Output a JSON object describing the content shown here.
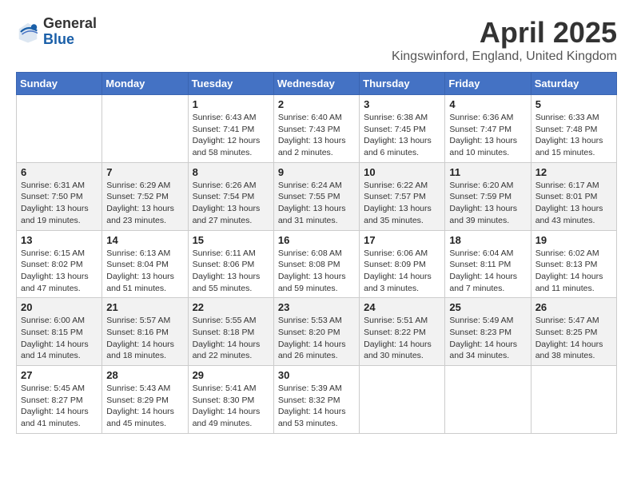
{
  "logo": {
    "general": "General",
    "blue": "Blue"
  },
  "title": "April 2025",
  "subtitle": "Kingswinford, England, United Kingdom",
  "days_of_week": [
    "Sunday",
    "Monday",
    "Tuesday",
    "Wednesday",
    "Thursday",
    "Friday",
    "Saturday"
  ],
  "weeks": [
    [
      {
        "day": "",
        "info": ""
      },
      {
        "day": "",
        "info": ""
      },
      {
        "day": "1",
        "info": "Sunrise: 6:43 AM\nSunset: 7:41 PM\nDaylight: 12 hours and 58 minutes."
      },
      {
        "day": "2",
        "info": "Sunrise: 6:40 AM\nSunset: 7:43 PM\nDaylight: 13 hours and 2 minutes."
      },
      {
        "day": "3",
        "info": "Sunrise: 6:38 AM\nSunset: 7:45 PM\nDaylight: 13 hours and 6 minutes."
      },
      {
        "day": "4",
        "info": "Sunrise: 6:36 AM\nSunset: 7:47 PM\nDaylight: 13 hours and 10 minutes."
      },
      {
        "day": "5",
        "info": "Sunrise: 6:33 AM\nSunset: 7:48 PM\nDaylight: 13 hours and 15 minutes."
      }
    ],
    [
      {
        "day": "6",
        "info": "Sunrise: 6:31 AM\nSunset: 7:50 PM\nDaylight: 13 hours and 19 minutes."
      },
      {
        "day": "7",
        "info": "Sunrise: 6:29 AM\nSunset: 7:52 PM\nDaylight: 13 hours and 23 minutes."
      },
      {
        "day": "8",
        "info": "Sunrise: 6:26 AM\nSunset: 7:54 PM\nDaylight: 13 hours and 27 minutes."
      },
      {
        "day": "9",
        "info": "Sunrise: 6:24 AM\nSunset: 7:55 PM\nDaylight: 13 hours and 31 minutes."
      },
      {
        "day": "10",
        "info": "Sunrise: 6:22 AM\nSunset: 7:57 PM\nDaylight: 13 hours and 35 minutes."
      },
      {
        "day": "11",
        "info": "Sunrise: 6:20 AM\nSunset: 7:59 PM\nDaylight: 13 hours and 39 minutes."
      },
      {
        "day": "12",
        "info": "Sunrise: 6:17 AM\nSunset: 8:01 PM\nDaylight: 13 hours and 43 minutes."
      }
    ],
    [
      {
        "day": "13",
        "info": "Sunrise: 6:15 AM\nSunset: 8:02 PM\nDaylight: 13 hours and 47 minutes."
      },
      {
        "day": "14",
        "info": "Sunrise: 6:13 AM\nSunset: 8:04 PM\nDaylight: 13 hours and 51 minutes."
      },
      {
        "day": "15",
        "info": "Sunrise: 6:11 AM\nSunset: 8:06 PM\nDaylight: 13 hours and 55 minutes."
      },
      {
        "day": "16",
        "info": "Sunrise: 6:08 AM\nSunset: 8:08 PM\nDaylight: 13 hours and 59 minutes."
      },
      {
        "day": "17",
        "info": "Sunrise: 6:06 AM\nSunset: 8:09 PM\nDaylight: 14 hours and 3 minutes."
      },
      {
        "day": "18",
        "info": "Sunrise: 6:04 AM\nSunset: 8:11 PM\nDaylight: 14 hours and 7 minutes."
      },
      {
        "day": "19",
        "info": "Sunrise: 6:02 AM\nSunset: 8:13 PM\nDaylight: 14 hours and 11 minutes."
      }
    ],
    [
      {
        "day": "20",
        "info": "Sunrise: 6:00 AM\nSunset: 8:15 PM\nDaylight: 14 hours and 14 minutes."
      },
      {
        "day": "21",
        "info": "Sunrise: 5:57 AM\nSunset: 8:16 PM\nDaylight: 14 hours and 18 minutes."
      },
      {
        "day": "22",
        "info": "Sunrise: 5:55 AM\nSunset: 8:18 PM\nDaylight: 14 hours and 22 minutes."
      },
      {
        "day": "23",
        "info": "Sunrise: 5:53 AM\nSunset: 8:20 PM\nDaylight: 14 hours and 26 minutes."
      },
      {
        "day": "24",
        "info": "Sunrise: 5:51 AM\nSunset: 8:22 PM\nDaylight: 14 hours and 30 minutes."
      },
      {
        "day": "25",
        "info": "Sunrise: 5:49 AM\nSunset: 8:23 PM\nDaylight: 14 hours and 34 minutes."
      },
      {
        "day": "26",
        "info": "Sunrise: 5:47 AM\nSunset: 8:25 PM\nDaylight: 14 hours and 38 minutes."
      }
    ],
    [
      {
        "day": "27",
        "info": "Sunrise: 5:45 AM\nSunset: 8:27 PM\nDaylight: 14 hours and 41 minutes."
      },
      {
        "day": "28",
        "info": "Sunrise: 5:43 AM\nSunset: 8:29 PM\nDaylight: 14 hours and 45 minutes."
      },
      {
        "day": "29",
        "info": "Sunrise: 5:41 AM\nSunset: 8:30 PM\nDaylight: 14 hours and 49 minutes."
      },
      {
        "day": "30",
        "info": "Sunrise: 5:39 AM\nSunset: 8:32 PM\nDaylight: 14 hours and 53 minutes."
      },
      {
        "day": "",
        "info": ""
      },
      {
        "day": "",
        "info": ""
      },
      {
        "day": "",
        "info": ""
      }
    ]
  ]
}
